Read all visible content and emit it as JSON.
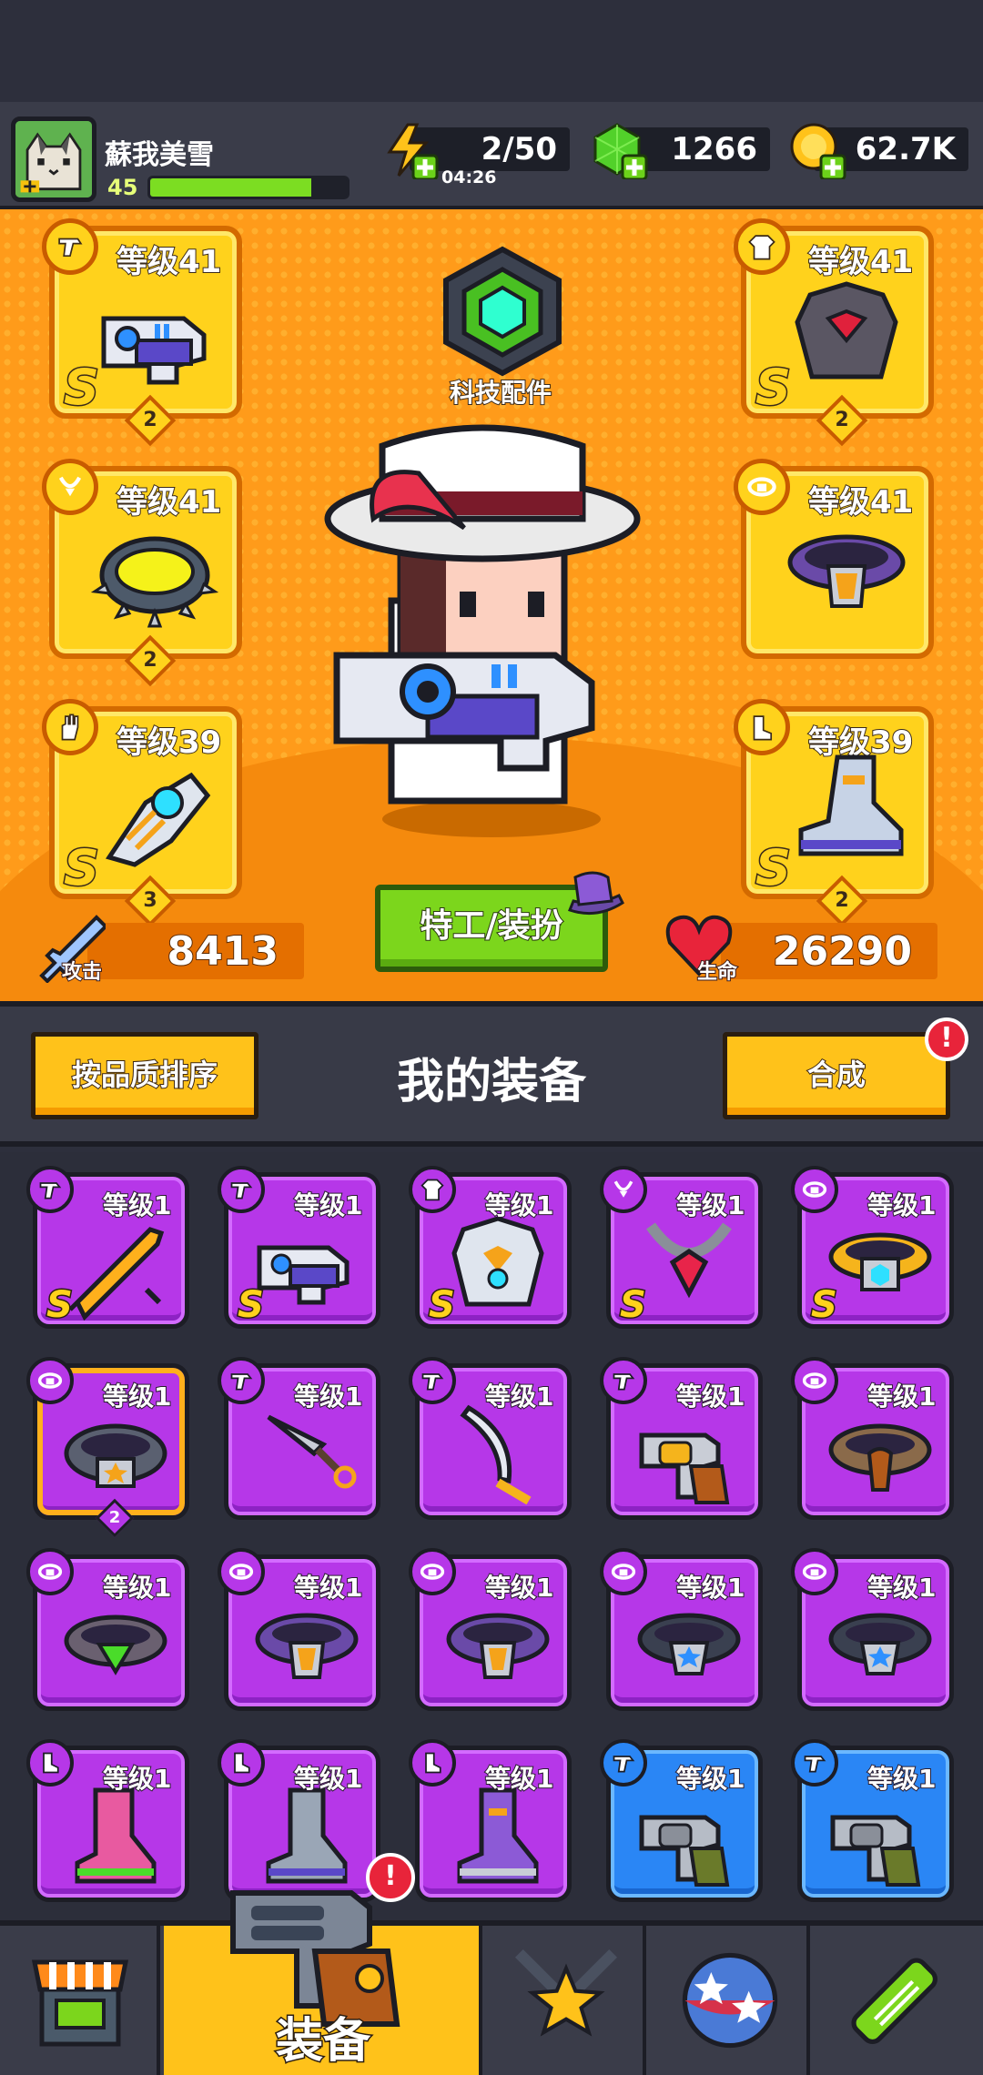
{
  "player": {
    "name": "蘇我美雪",
    "level": "45",
    "xp_fraction": 0.82
  },
  "resources": {
    "energy": {
      "value": "2/50",
      "timer": "04:26",
      "icon": "lightning-plus-icon"
    },
    "gems": {
      "value": "1266",
      "icon": "green-gem-plus-icon"
    },
    "coins": {
      "value": "62.7K",
      "icon": "gold-coin-plus-icon"
    }
  },
  "equipped": {
    "weapon": {
      "level": "等级41",
      "rank": "S",
      "stars": "2"
    },
    "armor": {
      "level": "等级41",
      "rank": "S",
      "stars": "2"
    },
    "necklace": {
      "level": "等级41",
      "stars": "2"
    },
    "belt": {
      "level": "等级41"
    },
    "glove": {
      "level": "等级39",
      "rank": "S",
      "stars": "3"
    },
    "boots": {
      "level": "等级39",
      "rank": "S",
      "stars": "2"
    }
  },
  "tech_parts_label": "科技配件",
  "agent_button": "特工/装扮",
  "stats": {
    "attack_label": "攻击",
    "attack_value": "8413",
    "hp_label": "生命",
    "hp_value": "26290"
  },
  "toolbar": {
    "sort_button": "按品质排序",
    "title": "我的装备",
    "merge_button": "合成",
    "merge_alert": "!"
  },
  "inventory": [
    {
      "level": "等级1",
      "rank": "S",
      "slot": "weapon",
      "art": "flame-sword",
      "color": "purple"
    },
    {
      "level": "等级1",
      "rank": "S",
      "slot": "weapon",
      "art": "blaster-gun",
      "color": "purple"
    },
    {
      "level": "等级1",
      "rank": "S",
      "slot": "armor",
      "art": "robot-armor",
      "color": "purple"
    },
    {
      "level": "等级1",
      "rank": "S",
      "slot": "necklace",
      "art": "chain-necklace",
      "color": "purple"
    },
    {
      "level": "等级1",
      "rank": "S",
      "slot": "belt",
      "art": "gold-belt",
      "color": "purple"
    },
    {
      "level": "等级1",
      "rank": "",
      "slot": "belt",
      "art": "star-belt",
      "color": "purple",
      "stars": "2"
    },
    {
      "level": "等级1",
      "rank": "",
      "slot": "weapon",
      "art": "kunai",
      "color": "purple"
    },
    {
      "level": "等级1",
      "rank": "",
      "slot": "weapon",
      "art": "scimitar",
      "color": "purple"
    },
    {
      "level": "等级1",
      "rank": "",
      "slot": "weapon",
      "art": "revolver",
      "color": "purple"
    },
    {
      "level": "等级1",
      "rank": "",
      "slot": "belt",
      "art": "rope-belt",
      "color": "purple"
    },
    {
      "level": "等级1",
      "rank": "",
      "slot": "belt",
      "art": "green-gem-belt",
      "color": "purple"
    },
    {
      "level": "等级1",
      "rank": "",
      "slot": "belt",
      "art": "orange-belt",
      "color": "purple"
    },
    {
      "level": "等级1",
      "rank": "",
      "slot": "belt",
      "art": "orange-belt",
      "color": "purple"
    },
    {
      "level": "等级1",
      "rank": "",
      "slot": "belt",
      "art": "blue-star-belt",
      "color": "purple"
    },
    {
      "level": "等级1",
      "rank": "",
      "slot": "belt",
      "art": "blue-star-belt",
      "color": "purple"
    },
    {
      "level": "等级1",
      "rank": "",
      "slot": "boots",
      "art": "pink-boots",
      "color": "purple"
    },
    {
      "level": "等级1",
      "rank": "",
      "slot": "boots",
      "art": "grey-boots",
      "color": "purple"
    },
    {
      "level": "等级1",
      "rank": "",
      "slot": "boots",
      "art": "purple-boots",
      "color": "purple"
    },
    {
      "level": "等级1",
      "rank": "",
      "slot": "weapon",
      "art": "green-revolver",
      "color": "blue"
    },
    {
      "level": "等级1",
      "rank": "",
      "slot": "weapon",
      "art": "green-revolver",
      "color": "blue"
    }
  ],
  "nav": {
    "items": [
      {
        "icon": "shop-icon"
      },
      {
        "icon": "equipment-gun-icon",
        "label": "装备",
        "alert": "!"
      },
      {
        "icon": "star-swords-icon"
      },
      {
        "icon": "star-ball-icon"
      },
      {
        "icon": "dna-capsule-icon"
      }
    ]
  }
}
